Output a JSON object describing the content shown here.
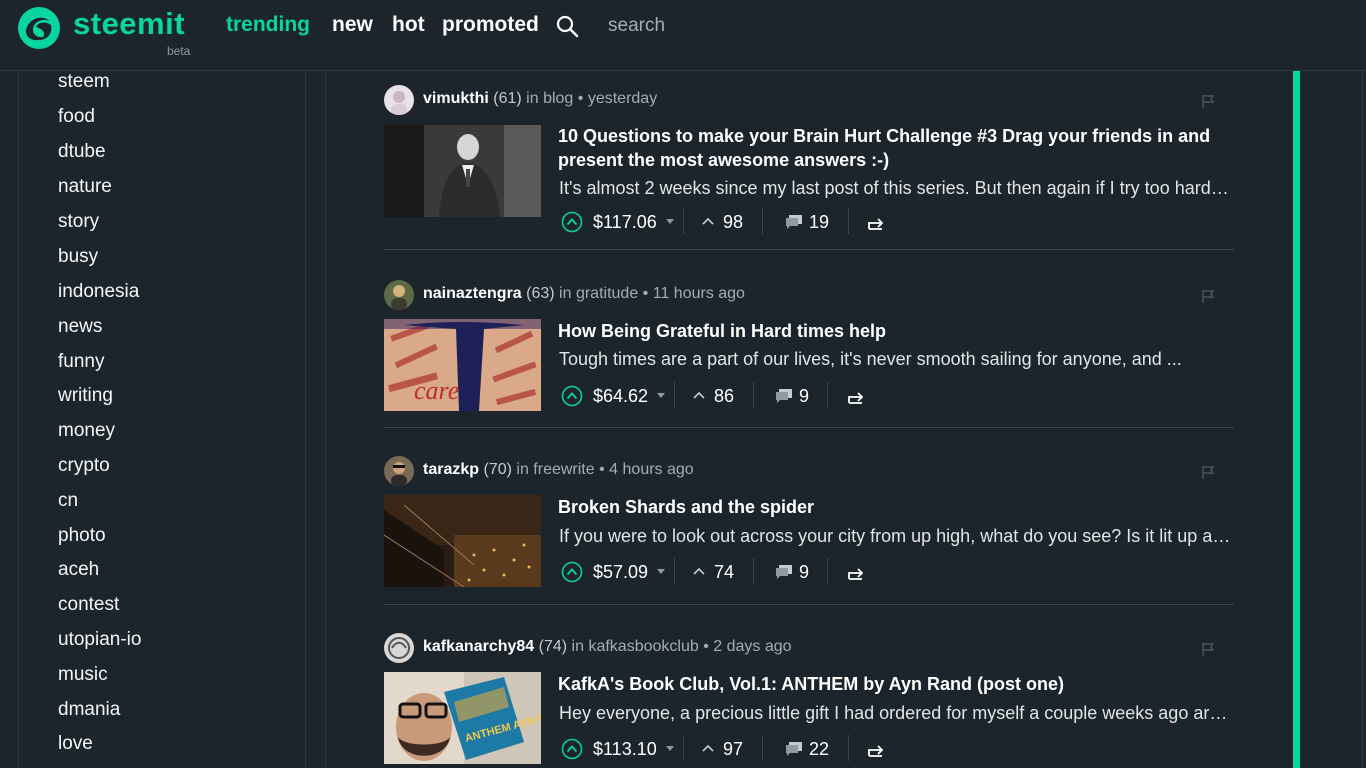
{
  "header": {
    "logo_text": "steemit",
    "beta": "beta",
    "nav": [
      {
        "label": "trending",
        "active": true
      },
      {
        "label": "new",
        "active": false
      },
      {
        "label": "hot",
        "active": false
      },
      {
        "label": "promoted",
        "active": false
      }
    ],
    "search_placeholder": "search"
  },
  "colors": {
    "accent": "#07d6a0",
    "background": "#1c252b"
  },
  "sidebar": {
    "tags": [
      "steem",
      "food",
      "dtube",
      "nature",
      "story",
      "busy",
      "indonesia",
      "news",
      "funny",
      "writing",
      "money",
      "crypto",
      "cn",
      "photo",
      "aceh",
      "contest",
      "utopian-io",
      "music",
      "dmania",
      "love"
    ]
  },
  "posts": [
    {
      "author": "vimukthi",
      "rep": "(61)",
      "category": "blog",
      "time": "yesterday",
      "title": "10 Questions to make your Brain Hurt Challenge #3 Drag your friends in and present the most awesome answers :-)",
      "excerpt": "It's almost 2 weeks since my last post of this series. But then again if I try too hard I might get a headache myself...",
      "payout": "$117.06",
      "votes": "98",
      "comments": "19",
      "thumb": "man-in-suit-photo"
    },
    {
      "author": "nainaztengra",
      "rep": "(63)",
      "category": "gratitude",
      "time": "11 hours ago",
      "title": "How Being Grateful in Hard times help",
      "excerpt": "Tough times are a part of our lives, it's never smooth sailing for anyone, and ...",
      "payout": "$64.62",
      "votes": "86",
      "comments": "9",
      "thumb": "word-collage-silhouette"
    },
    {
      "author": "tarazkp",
      "rep": "(70)",
      "category": "freewrite",
      "time": "4 hours ago",
      "title": "Broken Shards and the spider",
      "excerpt": "If you were to look out across your city from up high, what do you see? Is it lit up at night...",
      "payout": "$57.09",
      "votes": "74",
      "comments": "9",
      "thumb": "city-night-view"
    },
    {
      "author": "kafkanarchy84",
      "rep": "(74)",
      "category": "kafkasbookclub",
      "time": "2 days ago",
      "title": "KafkA's Book Club, Vol.1: ANTHEM by Ayn Rand (post one)",
      "excerpt": "Hey everyone, a precious little gift I had ordered for myself a couple weeks ago arrived...",
      "payout": "$113.10",
      "votes": "97",
      "comments": "22",
      "thumb": "man-holding-anthem-book",
      "thumb_text": "ANTHEM AYN RAND"
    }
  ],
  "labels": {
    "in": "in",
    "dot": "•"
  }
}
